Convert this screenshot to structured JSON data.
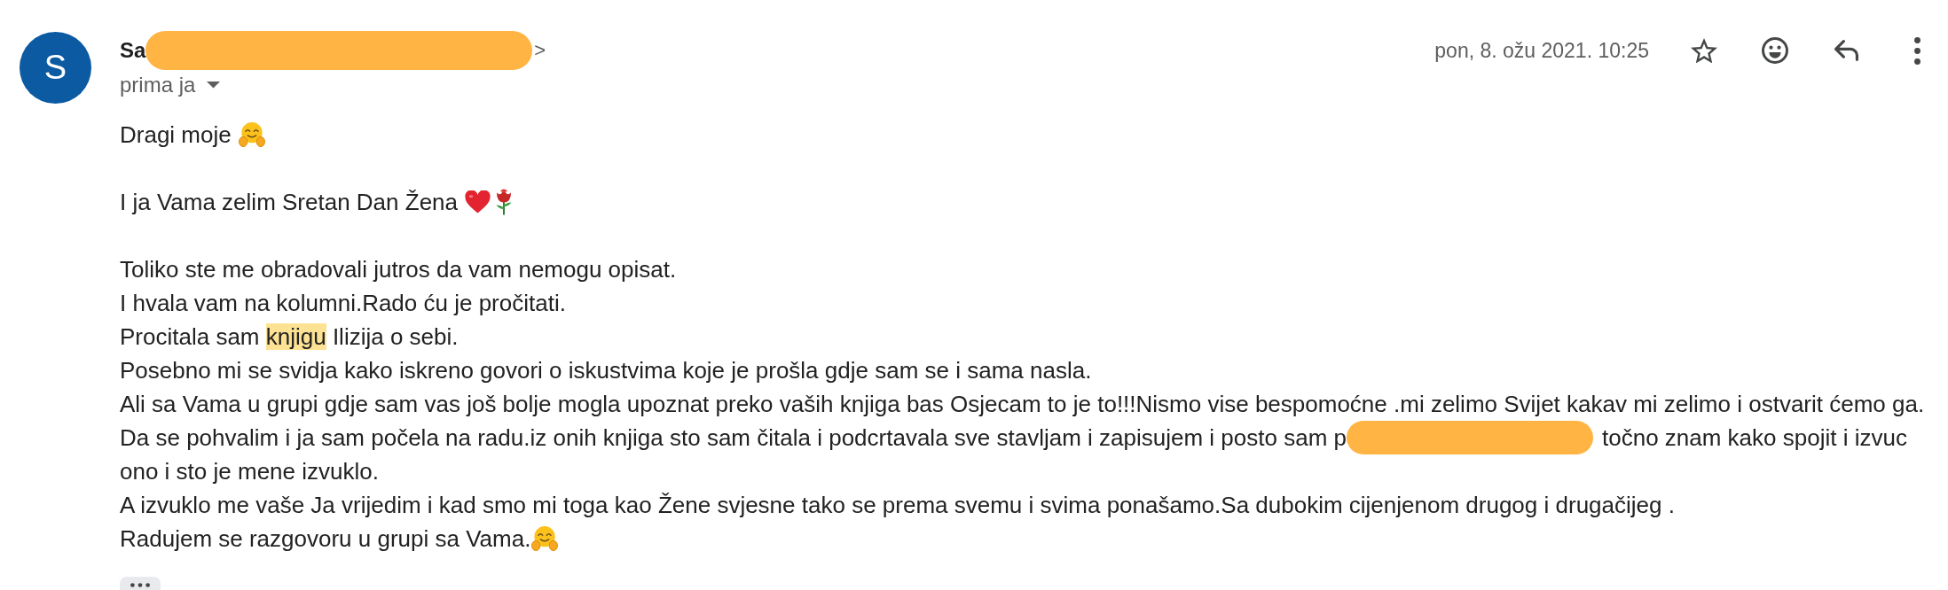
{
  "message": {
    "avatar": {
      "letter": "S"
    },
    "sender": {
      "name": "Sa",
      "redacted": true,
      "email_end": ">"
    },
    "recipient": {
      "label": "prima ja",
      "expanded": false
    },
    "date": "pon, 8. ožu 2021. 10:25",
    "star": {
      "starred": false
    },
    "actions": [
      {
        "kind": "react"
      },
      {
        "kind": "reply"
      },
      {
        "kind": "more"
      }
    ]
  },
  "body": {
    "paragraphs": [
      {
        "lines": [
          {
            "segments": [
              {
                "kind": "text",
                "text": "Dragi moje "
              },
              {
                "kind": "hug"
              }
            ]
          }
        ]
      },
      {
        "lines": [
          {
            "segments": [
              {
                "kind": "text",
                "text": "I ja Vama zelim Sretan Dan Žena "
              },
              {
                "kind": "heart"
              },
              {
                "kind": "rose"
              }
            ]
          }
        ]
      },
      {
        "lines": [
          {
            "segments": [
              {
                "kind": "text",
                "text": "Toliko ste me obradovali jutros da vam nemogu opisat."
              }
            ]
          },
          {
            "segments": [
              {
                "kind": "text",
                "text": "I hvala vam na kolumni.Rado ću je pročitati."
              }
            ]
          },
          {
            "segments": [
              {
                "kind": "text",
                "parts": [
                  {
                    "text": "Procitala sam ",
                    "highlighted": false
                  },
                  {
                    "text": "knjigu",
                    "highlighted": true
                  },
                  {
                    "text": " Ilizija o sebi.",
                    "highlighted": false
                  }
                ]
              }
            ]
          },
          {
            "segments": [
              {
                "kind": "text",
                "text": "Posebno mi se svidja kako iskreno govori o iskustvima koje je prošla gdje sam se i sama nasla."
              }
            ]
          },
          {
            "segments": [
              {
                "kind": "text",
                "text": "Ali sa Vama u grupi gdje sam vas još bolje mogla upoznat preko vaših knjiga bas Osjecam to je to!!!Nismo vise bespomoćne .mi zelimo Svijet kakav mi zelimo i ostvarit ćemo ga."
              }
            ]
          },
          {
            "segments": [
              {
                "kind": "text",
                "text": "Da se pohvalim i ja sam počela na radu.iz onih knjiga sto sam čitala i podcrtavala sve stavljam i zapisujem i posto sam p"
              },
              {
                "kind": "redaction"
              },
              {
                "kind": "text",
                "text": "točno znam kako spojit i izvuc"
              }
            ]
          },
          {
            "segments": [
              {
                "kind": "text",
                "text": "ono i sto je mene izvuklo."
              }
            ]
          },
          {
            "segments": [
              {
                "kind": "text",
                "text": "A izvuklo me vaše Ja vrijedim i kad smo mi toga kao Žene svjesne tako se prema svemu i svima ponašamo.Sa dubokim cijenjenom drugog i drugačijeg ."
              }
            ]
          },
          {
            "segments": [
              {
                "kind": "text",
                "text": "Radujem se razgovoru u grupi sa Vama."
              },
              {
                "kind": "hug"
              }
            ]
          }
        ]
      }
    ],
    "trimmed_content_button": true
  }
}
